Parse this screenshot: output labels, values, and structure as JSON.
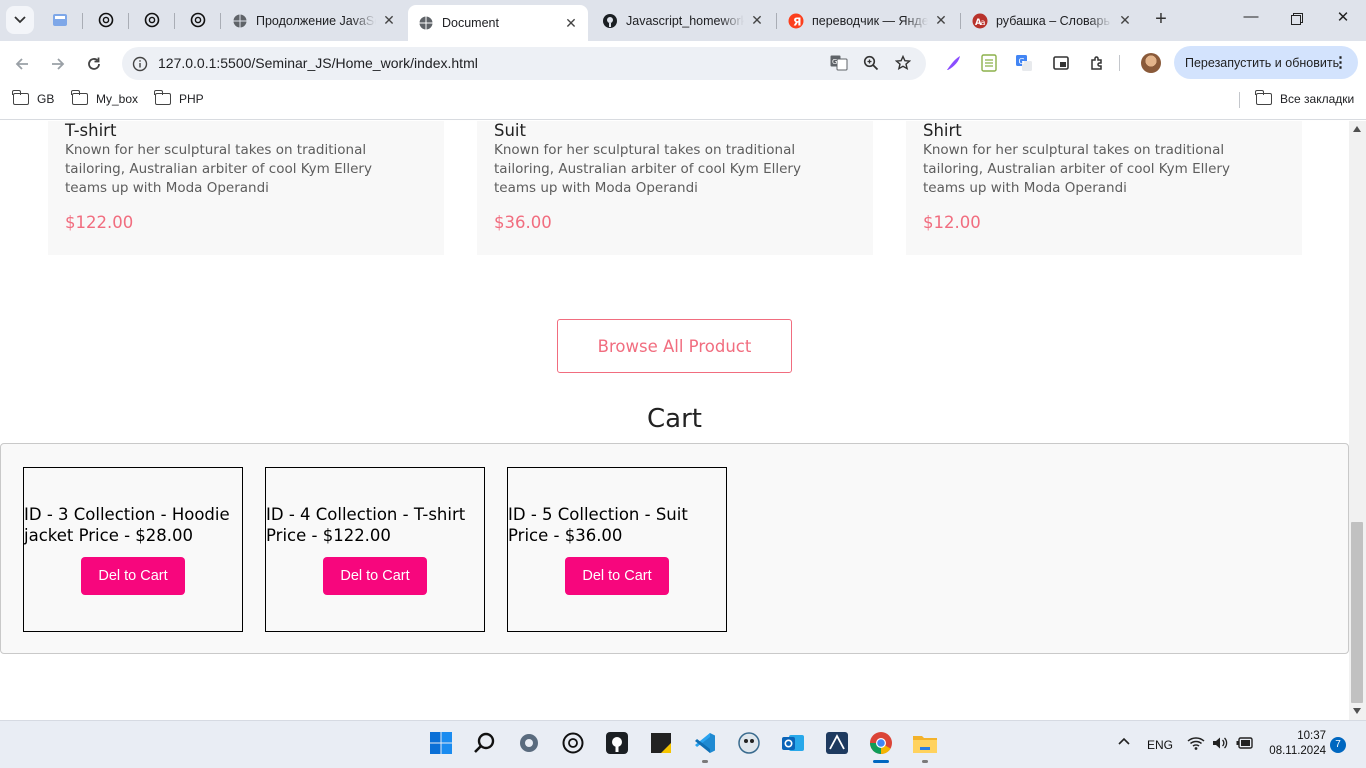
{
  "browser": {
    "tabs": [
      {
        "label": "",
        "icon": "blue-box-icon"
      },
      {
        "label": "",
        "icon": "openai-icon"
      },
      {
        "label": "",
        "icon": "openai-icon"
      },
      {
        "label": "",
        "icon": "openai-icon"
      },
      {
        "label": "Продолжение JavaSc",
        "icon": "globe-icon"
      },
      {
        "label": "Document",
        "icon": "globe-icon",
        "active": true
      },
      {
        "label": "Javascript_homework",
        "icon": "github-icon"
      },
      {
        "label": "переводчик — Яндекс",
        "icon": "yandex-icon"
      },
      {
        "label": "рубашка – Словарь",
        "icon": "dictionary-icon"
      }
    ],
    "url": "127.0.0.1:5500/Seminar_JS/Home_work/index.html",
    "relaunch_label": "Перезапустить и обновить",
    "bookmarks": [
      "GB",
      "My_box",
      "PHP"
    ],
    "all_bookmarks_label": "Все закладки"
  },
  "page": {
    "products": [
      {
        "name": "T-shirt",
        "description": "Known for her sculptural takes on traditional tailoring, Australian arbiter of cool Kym Ellery teams up with Moda Operandi",
        "price": "$122.00"
      },
      {
        "name": "Suit",
        "description": "Known for her sculptural takes on traditional tailoring, Australian arbiter of cool Kym Ellery teams up with Moda Operandi",
        "price": "$36.00"
      },
      {
        "name": "Shirt",
        "description": "Known for her sculptural takes on traditional tailoring, Australian arbiter of cool Kym Ellery teams up with Moda Operandi",
        "price": "$12.00"
      }
    ],
    "browse_button": "Browse All Product",
    "cart_title": "Cart",
    "cart_items": [
      {
        "text": "ID - 3 Collection - Hoodie jacket Price - $28.00",
        "button": "Del to Cart"
      },
      {
        "text": "ID - 4 Collection - T-shirt Price - $122.00",
        "button": "Del to Cart"
      },
      {
        "text": "ID - 5 Collection - Suit Price - $36.00",
        "button": "Del to Cart"
      }
    ],
    "colors": {
      "accent": "#f16d7f",
      "delete_button": "#f7067d"
    }
  },
  "taskbar": {
    "language": "ENG",
    "time": "10:37",
    "date": "08.11.2024",
    "notifications": "7"
  }
}
